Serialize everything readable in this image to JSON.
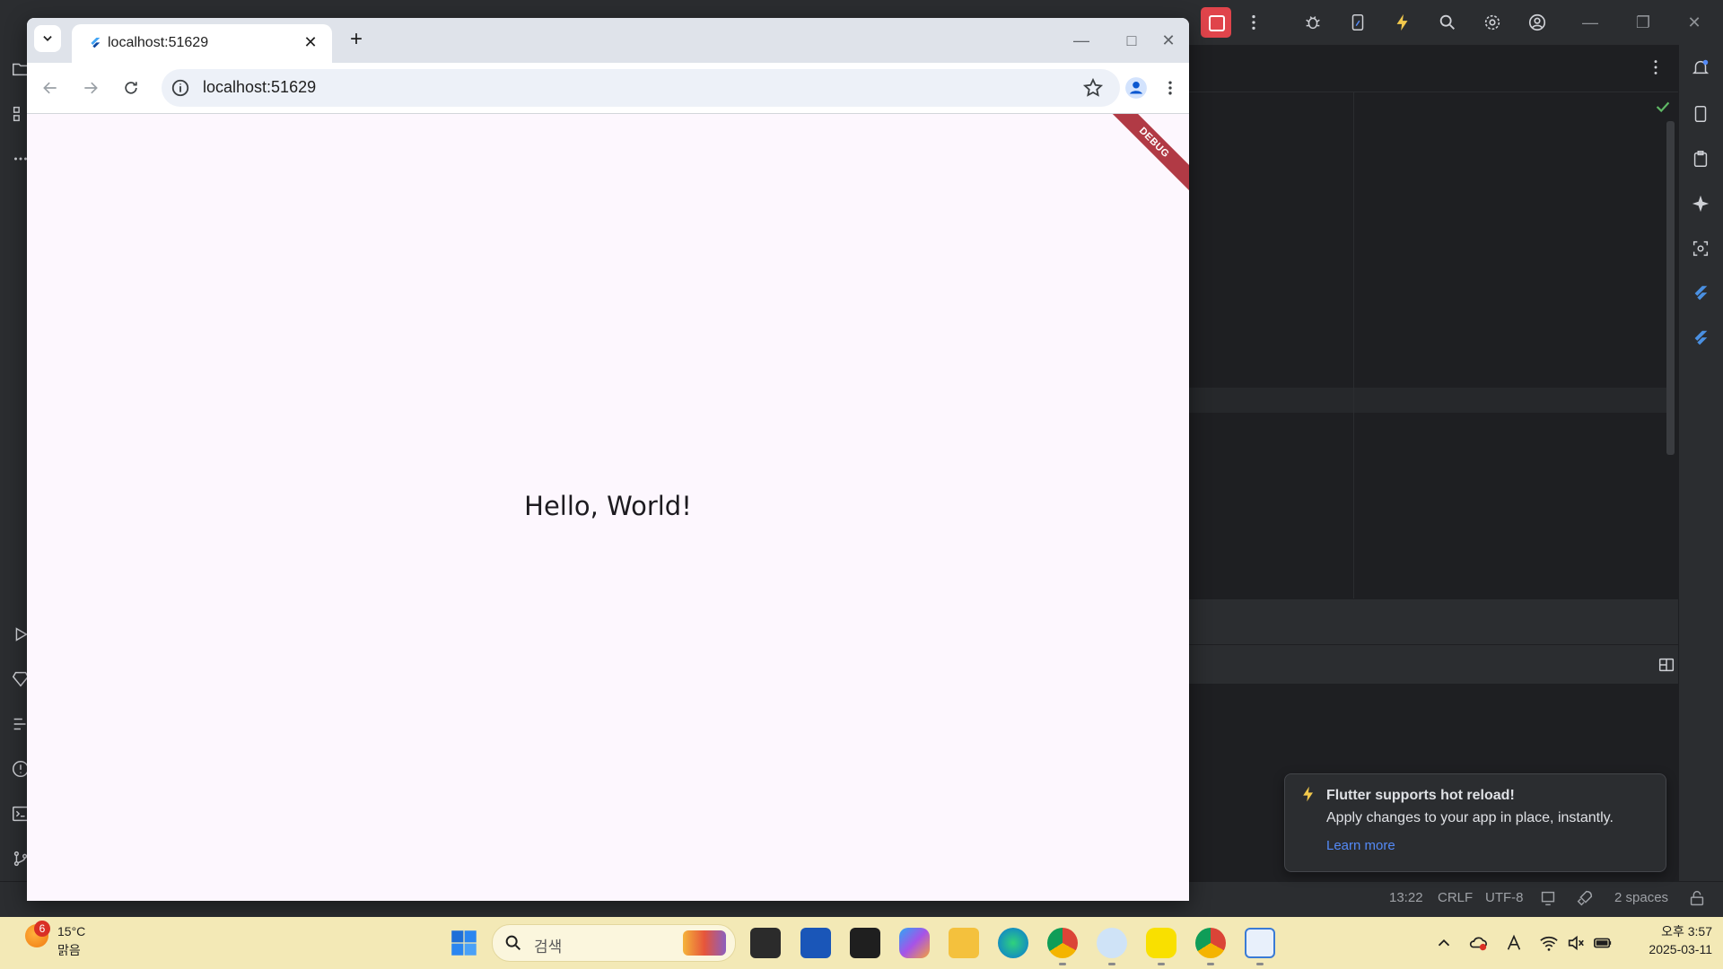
{
  "browser": {
    "tab_title": "localhost:51629",
    "url": "localhost:51629",
    "page_text": "Hello, World!",
    "debug_banner": "DEBUG"
  },
  "ide": {
    "status": {
      "position": "13:22",
      "line_ending": "CRLF",
      "encoding": "UTF-8",
      "indent": "2 spaces"
    },
    "toast": {
      "title": "Flutter supports hot reload!",
      "body": "Apply changes to your app in place, instantly.",
      "link": "Learn more"
    }
  },
  "taskbar": {
    "weather_badge": "6",
    "temperature": "15°C",
    "condition": "맑음",
    "search_placeholder": "검색",
    "time": "오후 3:57",
    "date": "2025-03-11"
  },
  "colors": {
    "ide_bg": "#1e1f22",
    "ide_panel": "#2b2d30",
    "flutter_bg": "#fdf7fe",
    "debug_banner": "#b13a45",
    "link": "#548af7",
    "taskbar": "#f3e9b6"
  }
}
